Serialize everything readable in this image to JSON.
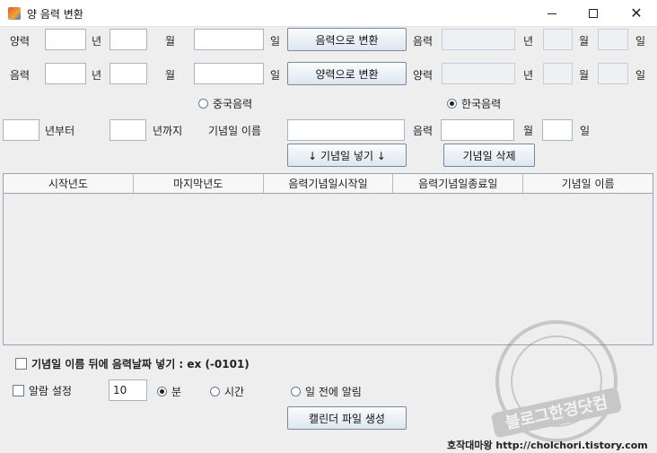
{
  "window": {
    "title": "양 음력 변환"
  },
  "solar_row": {
    "label": "양력",
    "year_unit": "년",
    "month_unit": "월",
    "day_unit": "일",
    "year_value": "",
    "month_value": "",
    "day_value": "",
    "convert_button": "음력으로 변환",
    "result_label": "음력",
    "result_year_unit": "년",
    "result_month_unit": "월",
    "result_day_unit": "일"
  },
  "lunar_row": {
    "label": "음력",
    "year_unit": "년",
    "month_unit": "월",
    "day_unit": "일",
    "convert_button": "양력으로 변환",
    "result_label": "양력",
    "result_year_unit": "년",
    "result_month_unit": "월",
    "result_day_unit": "일"
  },
  "calendar_type": {
    "option_china": "중국음력",
    "option_korea": "한국음력",
    "selected": "korea"
  },
  "anniversary": {
    "from_label": "년부터",
    "to_label": "년까지",
    "name_label": "기념일 이름",
    "lunar_label": "음력",
    "month_unit": "월",
    "day_unit": "일",
    "add_button": "↓ 기념일 넣기 ↓",
    "delete_button": "기념일 삭제"
  },
  "table": {
    "columns": [
      "시작년도",
      "마지막년도",
      "음력기념일시작일",
      "음력기념일종료일",
      "기념일 이름"
    ],
    "rows": []
  },
  "options": {
    "append_lunar_date_label": "기념일 이름 뒤에 음력날짜 넣기 : ex (-0101)",
    "alarm_label": "알람 설정",
    "alarm_value": "10",
    "unit_minute": "분",
    "unit_hour": "시간",
    "unit_day_before": "일 전에 알림",
    "selected_unit": "minute"
  },
  "footer": {
    "create_button": "캘린더 파일 생성",
    "credit": "호작대마왕 http://cholchori.tistory.com"
  },
  "watermark": {
    "text": "블로그한경닷컴"
  }
}
